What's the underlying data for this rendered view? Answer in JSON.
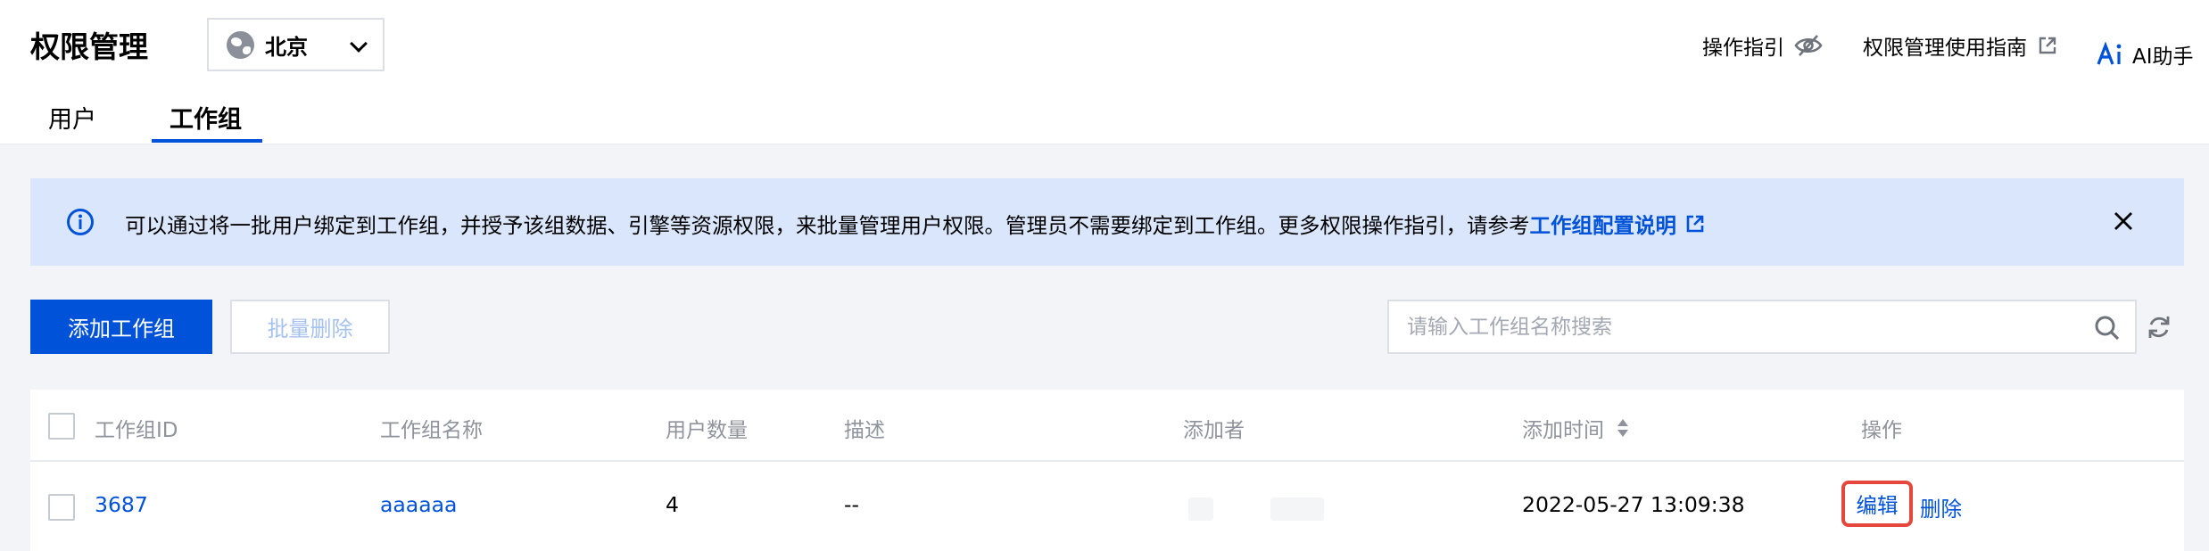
{
  "header": {
    "title": "权限管理",
    "region": "北京",
    "guide_label": "操作指引",
    "manual_link": "权限管理使用指南",
    "ai_label": "AI助手"
  },
  "tabs": [
    {
      "label": "用户",
      "active": false
    },
    {
      "label": "工作组",
      "active": true
    }
  ],
  "banner": {
    "text": "可以通过将一批用户绑定到工作组，并授予该组数据、引擎等资源权限，来批量管理用户权限。管理员不需要绑定到工作组。更多权限操作指引，请参考",
    "link": "工作组配置说明"
  },
  "toolbar": {
    "add_label": "添加工作组",
    "batch_delete_label": "批量删除",
    "search_placeholder": "请输入工作组名称搜索"
  },
  "table": {
    "columns": [
      "工作组ID",
      "工作组名称",
      "用户数量",
      "描述",
      "添加者",
      "添加时间",
      "操作"
    ],
    "rows": [
      {
        "id": "3687",
        "name": "aaaaaa",
        "user_count": "4",
        "description": "--",
        "added_at": "2022-05-27 13:09:38",
        "actions": {
          "edit": "编辑",
          "delete": "删除"
        }
      }
    ]
  },
  "colors": {
    "primary": "#0052d9",
    "banner_bg": "#d9e6fc",
    "highlight_border": "#e5473a",
    "page_bg": "#f2f4f8"
  },
  "icons": [
    "globe-icon",
    "chevron-down-icon",
    "eye-off-icon",
    "external-link-icon",
    "ai-icon",
    "info-icon",
    "close-icon",
    "search-icon",
    "refresh-icon",
    "sort-icon"
  ]
}
